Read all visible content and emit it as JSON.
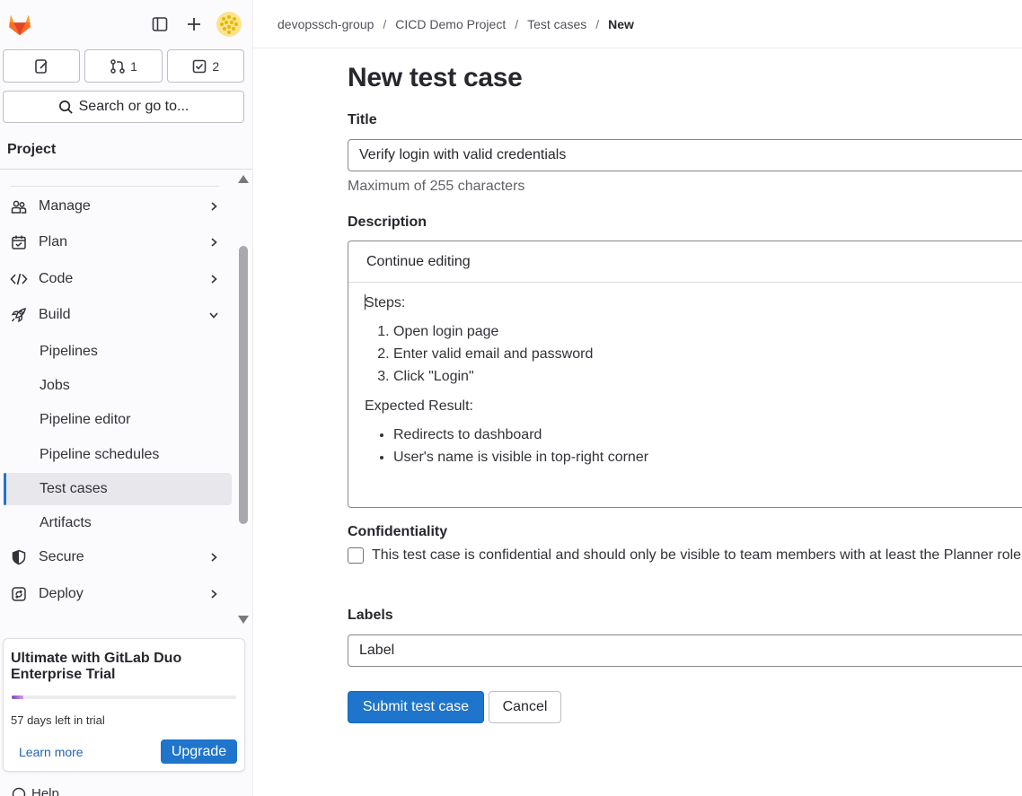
{
  "sidebar": {
    "counts": {
      "merge_requests": "1",
      "todos": "2"
    },
    "search_label": "Search or go to...",
    "section_title": "Project",
    "items": {
      "manage": "Manage",
      "plan": "Plan",
      "code": "Code",
      "build": "Build",
      "secure": "Secure",
      "deploy": "Deploy"
    },
    "build_sub": {
      "pipelines": "Pipelines",
      "jobs": "Jobs",
      "pipeline_editor": "Pipeline editor",
      "pipeline_schedules": "Pipeline schedules",
      "test_cases": "Test cases",
      "artifacts": "Artifacts"
    },
    "trial": {
      "title": "Ultimate with GitLab Duo Enterprise Trial",
      "days_left": "57 days left in trial",
      "progress_fraction": 0.05,
      "learn_more": "Learn more",
      "upgrade": "Upgrade"
    },
    "help_label": "Help"
  },
  "breadcrumb": {
    "group": "devopssch-group",
    "project": "CICD Demo Project",
    "section": "Test cases",
    "current": "New"
  },
  "form": {
    "page_title": "New test case",
    "title_label": "Title",
    "title_value": "Verify login with valid credentials",
    "title_help": "Maximum of 255 characters",
    "description_label": "Description",
    "editor_tab": "Continue editing",
    "description": {
      "steps_heading": "Steps:",
      "steps": [
        "Open login page",
        "Enter valid email and password",
        "Click \"Login\""
      ],
      "expected_heading": "Expected Result:",
      "expected": [
        "Redirects to dashboard",
        "User's name is visible in top-right corner"
      ]
    },
    "confidentiality_label": "Confidentiality",
    "confidential_checkbox_text": "This test case is confidential and should only be visible to team members with at least the Planner role.",
    "labels_label": "Labels",
    "labels_value": "Label",
    "submit_label": "Submit test case",
    "cancel_label": "Cancel"
  },
  "colors": {
    "accent": "#1f75cb",
    "gitlab_orange": "#e24329",
    "sidebar_active": "#e8e7ec"
  },
  "icons": {
    "logo": "gitlab-tanuki-icon",
    "sidebar_toggle": "sidebar-toggle-icon",
    "new": "plus-icon",
    "issues": "issues-icon",
    "merge_requests": "merge-request-icon",
    "todos": "todo-icon",
    "search": "search-icon"
  }
}
